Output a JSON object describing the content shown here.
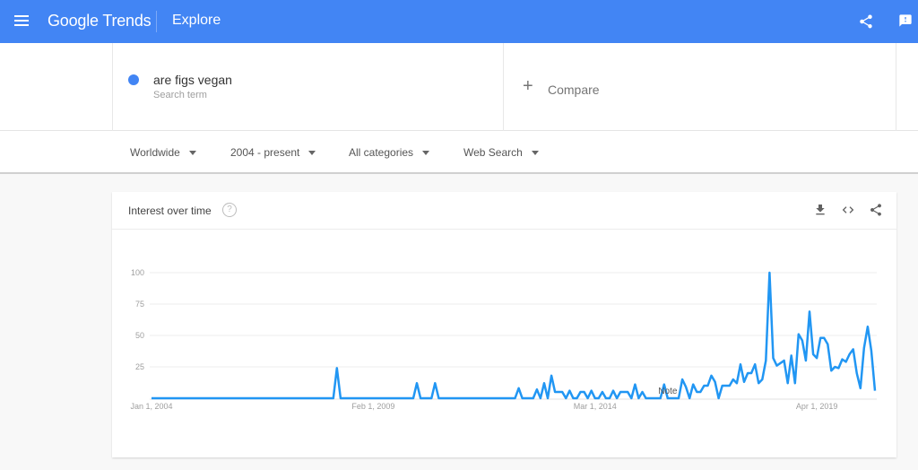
{
  "header": {
    "logo": "Google Trends",
    "section": "Explore",
    "brand_color": "#4285f4"
  },
  "search": {
    "term": "are figs vegan",
    "term_type": "Search term",
    "term_color": "#4285f4",
    "compare_label": "Compare",
    "compare_icon": "+"
  },
  "filters": [
    {
      "label": "Worldwide"
    },
    {
      "label": "2004 - present"
    },
    {
      "label": "All categories"
    },
    {
      "label": "Web Search"
    }
  ],
  "card": {
    "title": "Interest over time",
    "help_icon": "?"
  },
  "chart_data": {
    "type": "line",
    "title": "Interest over time",
    "xlabel": "",
    "ylabel": "",
    "ylim": [
      0,
      100
    ],
    "yticks": [
      25,
      50,
      75,
      100
    ],
    "x_tick_labels": [
      {
        "label": "Jan 1, 2004",
        "month_index": 0
      },
      {
        "label": "Feb 1, 2009",
        "month_index": 61
      },
      {
        "label": "Mar 1, 2014",
        "month_index": 122
      },
      {
        "label": "Apr 1, 2019",
        "month_index": 183
      }
    ],
    "grid": true,
    "line_color": "#2196f3",
    "annotation": {
      "label": "Note",
      "month_index": 142
    },
    "series": [
      {
        "name": "are figs vegan",
        "start": "Jan 2004",
        "frequency": "monthly",
        "values": [
          0,
          0,
          0,
          0,
          0,
          0,
          0,
          0,
          0,
          0,
          0,
          0,
          0,
          0,
          0,
          0,
          0,
          0,
          0,
          0,
          0,
          0,
          0,
          0,
          0,
          0,
          0,
          0,
          0,
          0,
          0,
          0,
          0,
          0,
          0,
          0,
          0,
          0,
          0,
          0,
          0,
          0,
          0,
          0,
          0,
          0,
          0,
          0,
          0,
          0,
          0,
          24,
          0,
          0,
          0,
          0,
          0,
          0,
          0,
          0,
          0,
          0,
          0,
          0,
          0,
          0,
          0,
          0,
          0,
          0,
          0,
          0,
          0,
          12,
          0,
          0,
          0,
          0,
          12,
          0,
          0,
          0,
          0,
          0,
          0,
          0,
          0,
          0,
          0,
          0,
          0,
          0,
          0,
          0,
          0,
          0,
          0,
          0,
          0,
          0,
          0,
          8,
          0,
          0,
          0,
          0,
          7,
          0,
          12,
          0,
          18,
          5,
          5,
          5,
          0,
          6,
          0,
          0,
          5,
          5,
          0,
          6,
          0,
          0,
          5,
          0,
          0,
          6,
          0,
          5,
          5,
          5,
          0,
          11,
          0,
          5,
          0,
          0,
          0,
          0,
          0,
          11,
          0,
          0,
          0,
          0,
          15,
          9,
          0,
          11,
          5,
          5,
          10,
          10,
          18,
          13,
          0,
          10,
          10,
          10,
          15,
          12,
          27,
          13,
          20,
          20,
          27,
          12,
          15,
          30,
          100,
          32,
          26,
          28,
          30,
          12,
          34,
          12,
          51,
          46,
          30,
          69,
          35,
          32,
          48,
          48,
          43,
          22,
          25,
          24,
          31,
          29,
          35,
          39,
          20,
          8,
          40,
          57,
          38,
          6
        ]
      }
    ]
  }
}
